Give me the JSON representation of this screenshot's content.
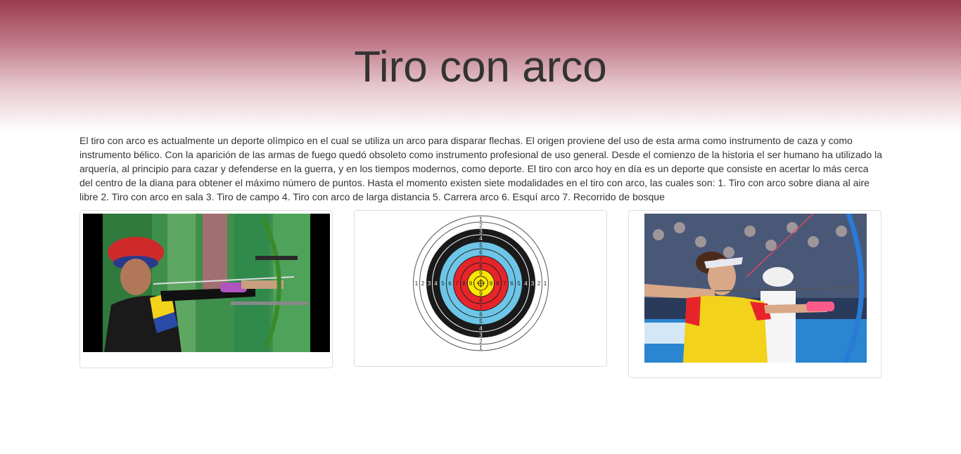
{
  "header": {
    "title": "Tiro con arco"
  },
  "intro": {
    "text": "El tiro con arco es actualmente un deporte olímpico en el cual se utiliza un arco para disparar flechas. El origen proviene del uso de esta arma como instrumento de caza y como instrumento bélico. Con la aparición de las armas de fuego quedó obsoleto como instrumento profesional de uso general. Desde el comienzo de la historia el ser humano ha utilizado la arquería, al principio para cazar y defenderse en la guerra, y en los tiempos modernos, como deporte. El tiro con arco hoy en día es un deporte que consiste en acertar lo más cerca del centro de la diana para obtener el máximo número de puntos. Hasta el momento existen siete modalidades en el tiro con arco, las cuales son: 1. Tiro con arco sobre diana al aire libre 2. Tiro con arco en sala 3. Tiro de campo 4. Tiro con arco de larga distancia 5. Carrera arco 6. Esquí arco 7. Recorrido de bosque"
  },
  "gallery": {
    "target_ring_numbers": [
      "1",
      "2",
      "3",
      "4",
      "5",
      "6",
      "7",
      "8",
      "9"
    ]
  },
  "colors": {
    "header_top": "#9b3a4f",
    "text": "#333333",
    "card_border": "#dddddd",
    "target_gold": "#ffe600",
    "target_red": "#e8242b",
    "target_blue": "#6dc6e8",
    "target_black": "#1a1a1a"
  }
}
